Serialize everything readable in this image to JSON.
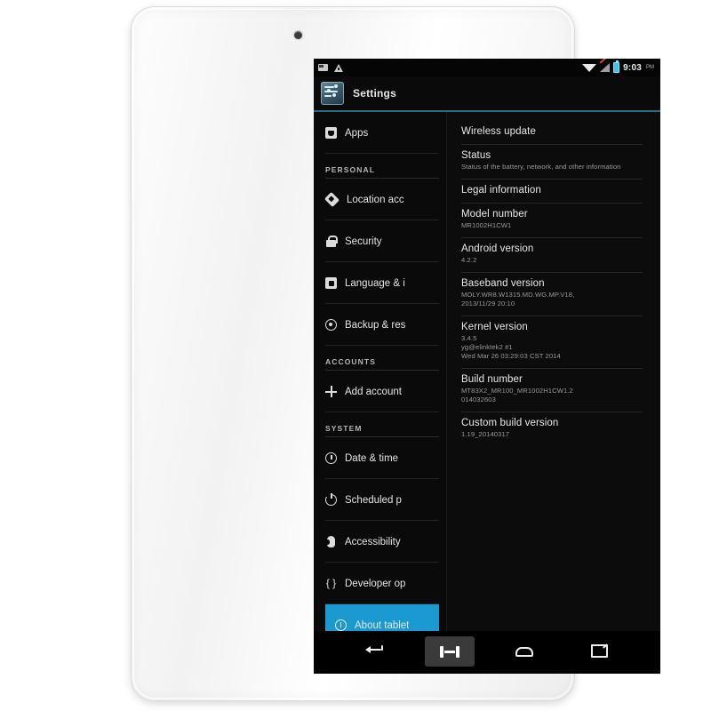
{
  "status_bar": {
    "icons_left": [
      "sd-card-icon",
      "warning-triangle-icon"
    ],
    "icons_right": [
      "wifi-icon",
      "mobile-signal-off-icon",
      "battery-icon"
    ],
    "time": "9:03",
    "meridiem": "PM"
  },
  "action_bar": {
    "app_icon": "settings-icon",
    "title": "Settings"
  },
  "sidebar": {
    "items": [
      {
        "type": "item",
        "label": "Apps",
        "icon": "apps-icon"
      },
      {
        "type": "header",
        "label": "PERSONAL"
      },
      {
        "type": "item",
        "label": "Location acc",
        "icon": "location-icon"
      },
      {
        "type": "item",
        "label": "Security",
        "icon": "lock-icon"
      },
      {
        "type": "item",
        "label": "Language & i",
        "icon": "language-icon"
      },
      {
        "type": "item",
        "label": "Backup & res",
        "icon": "backup-icon"
      },
      {
        "type": "header",
        "label": "ACCOUNTS"
      },
      {
        "type": "item",
        "label": "Add account",
        "icon": "plus-icon"
      },
      {
        "type": "header",
        "label": "SYSTEM"
      },
      {
        "type": "item",
        "label": "Date & time",
        "icon": "clock-icon"
      },
      {
        "type": "item",
        "label": "Scheduled p",
        "icon": "power-icon"
      },
      {
        "type": "item",
        "label": "Accessibility",
        "icon": "accessibility-icon"
      },
      {
        "type": "item",
        "label": "Developer op",
        "icon": "developer-braces-icon"
      },
      {
        "type": "item",
        "label": "About tablet",
        "icon": "info-icon",
        "selected": true
      }
    ],
    "selected_color": "#1b9ad1"
  },
  "content": {
    "items": [
      {
        "title": "Wireless update",
        "sub": ""
      },
      {
        "title": "Status",
        "sub": "Status of the battery, network, and other information"
      },
      {
        "title": "Legal information",
        "sub": ""
      },
      {
        "title": "Model number",
        "sub": "MR1002H1CW1"
      },
      {
        "title": "Android version",
        "sub": "4.2.2"
      },
      {
        "title": "Baseband version",
        "sub": "MOLY.WR8.W1315.MD.WG.MP.V18,\n2013/11/29 20:10"
      },
      {
        "title": "Kernel version",
        "sub": "3.4.5\nyg@elinktek2 #1\nWed Mar 26 03:29:03 CST 2014"
      },
      {
        "title": "Build number",
        "sub": "MT83X2_MR100_MR1002H1CW1.2\n014032603"
      },
      {
        "title": "Custom build version",
        "sub": "1.19_20140317"
      }
    ]
  },
  "nav_bar": {
    "buttons": [
      {
        "name": "back-icon",
        "highlighted": false
      },
      {
        "name": "screenshot-icon",
        "highlighted": true
      },
      {
        "name": "home-icon",
        "highlighted": false
      },
      {
        "name": "recents-icon",
        "highlighted": false
      }
    ]
  }
}
